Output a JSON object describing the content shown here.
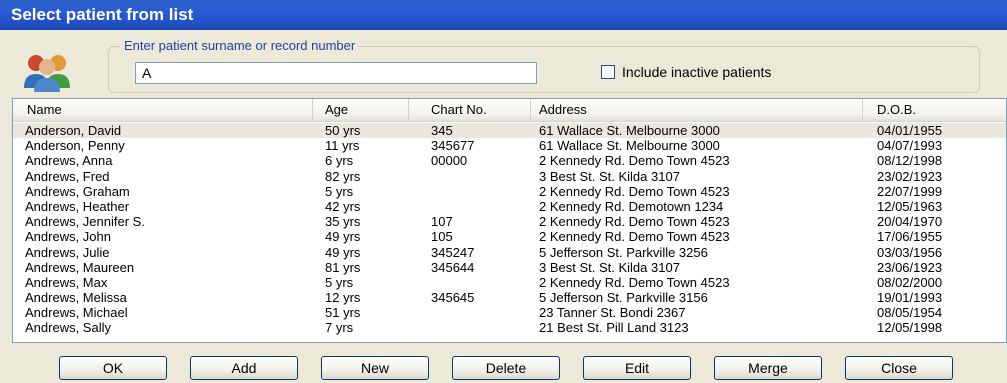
{
  "window": {
    "title": "Select patient from list"
  },
  "search": {
    "legend": "Enter patient surname or record number",
    "value": "A",
    "include_inactive_label": "Include inactive patients",
    "include_inactive_checked": false
  },
  "table": {
    "columns": [
      "Name",
      "Age",
      "Chart No.",
      "Address",
      "D.O.B."
    ],
    "rows": [
      {
        "name": "Anderson, David",
        "age": "50 yrs",
        "chart": "345",
        "address": "61 Wallace St. Melbourne 3000",
        "dob": "04/01/1955",
        "selected": true
      },
      {
        "name": "Anderson, Penny",
        "age": "11 yrs",
        "chart": "345677",
        "address": "61 Wallace St. Melbourne 3000",
        "dob": "04/07/1993"
      },
      {
        "name": "Andrews, Anna",
        "age": "6 yrs",
        "chart": "00000",
        "address": "2 Kennedy Rd. Demo Town 4523",
        "dob": "08/12/1998"
      },
      {
        "name": "Andrews, Fred",
        "age": "82 yrs",
        "chart": "",
        "address": "3 Best St. St. Kilda 3107",
        "dob": "23/02/1923"
      },
      {
        "name": "Andrews, Graham",
        "age": "5 yrs",
        "chart": "",
        "address": "2 Kennedy Rd. Demo Town 4523",
        "dob": "22/07/1999"
      },
      {
        "name": "Andrews, Heather",
        "age": "42 yrs",
        "chart": "",
        "address": "2 Kennedy Rd. Demotown 1234",
        "dob": "12/05/1963"
      },
      {
        "name": "Andrews, Jennifer S.",
        "age": "35 yrs",
        "chart": "107",
        "address": "2 Kennedy Rd. Demo Town 4523",
        "dob": "20/04/1970"
      },
      {
        "name": "Andrews, John",
        "age": "49 yrs",
        "chart": "105",
        "address": "2 Kennedy Rd. Demo Town 4523",
        "dob": "17/06/1955"
      },
      {
        "name": "Andrews, Julie",
        "age": "49 yrs",
        "chart": "345247",
        "address": "5 Jefferson St. Parkville 3256",
        "dob": "03/03/1956"
      },
      {
        "name": "Andrews, Maureen",
        "age": "81 yrs",
        "chart": "345644",
        "address": "3 Best St. St. Kilda 3107",
        "dob": "23/06/1923"
      },
      {
        "name": "Andrews, Max",
        "age": "5 yrs",
        "chart": "",
        "address": "2 Kennedy Rd. Demo Town 4523",
        "dob": "08/02/2000"
      },
      {
        "name": "Andrews, Melissa",
        "age": "12 yrs",
        "chart": "345645",
        "address": "5 Jefferson St. Parkville 3156",
        "dob": "19/01/1993"
      },
      {
        "name": "Andrews, Michael",
        "age": "51 yrs",
        "chart": "",
        "address": "23 Tanner St. Bondi 2367",
        "dob": "08/05/1954"
      },
      {
        "name": "Andrews, Sally",
        "age": "7 yrs",
        "chart": "",
        "address": "21 Best St. Pill Land 3123",
        "dob": "12/05/1998"
      }
    ]
  },
  "buttons": [
    {
      "label": "OK",
      "name": "ok-button"
    },
    {
      "label": "Add",
      "name": "add-button"
    },
    {
      "label": "New",
      "name": "new-button"
    },
    {
      "label": "Delete",
      "name": "delete-button"
    },
    {
      "label": "Edit",
      "name": "edit-button"
    },
    {
      "label": "Merge",
      "name": "merge-button"
    },
    {
      "label": "Close",
      "name": "close-button"
    }
  ],
  "icons": {
    "avatar": "patients-group-icon"
  },
  "colors": {
    "titlebar": "#2a5bd6",
    "legend": "#1d3fa8",
    "selected_row": "#eae7de"
  }
}
